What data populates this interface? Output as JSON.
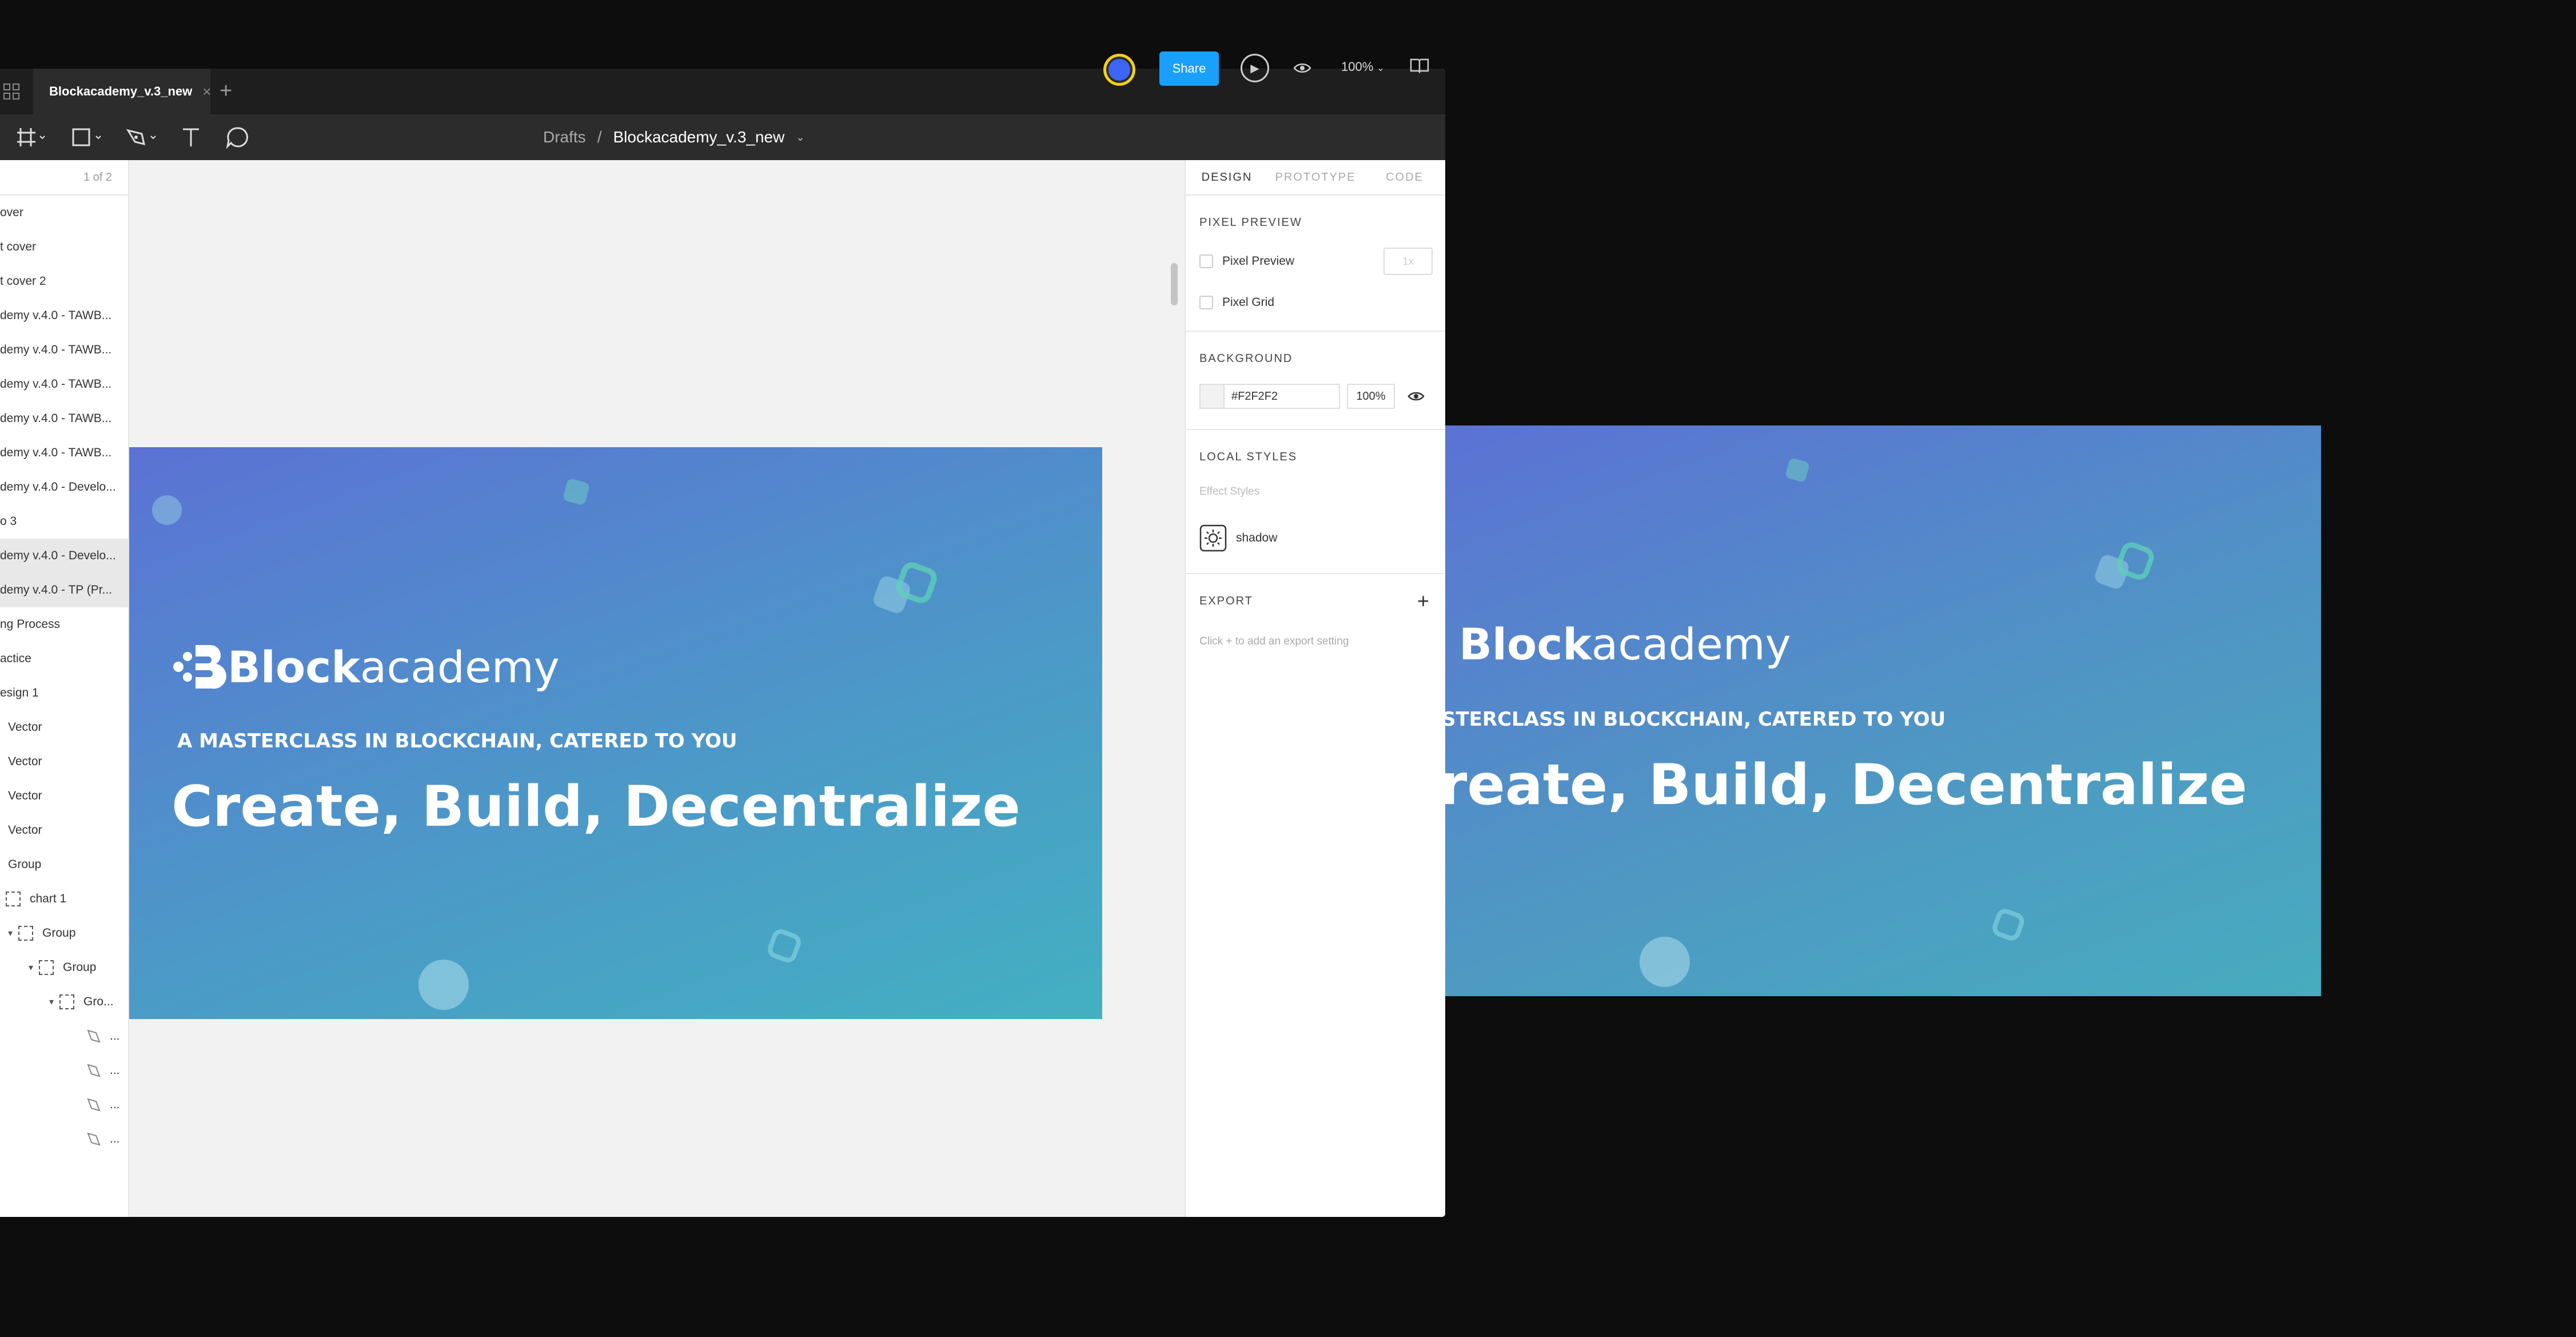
{
  "tabbar": {
    "file_tab": "Blockacademy_v.3_new",
    "close": "×",
    "add": "+"
  },
  "toolbar": {
    "breadcrumb_parent": "Drafts",
    "breadcrumb_sep": "/",
    "file_name": "Blockacademy_v.3_new",
    "share": "Share",
    "zoom": "100%"
  },
  "layers": {
    "pages_indicator": "1 of 2",
    "items": [
      {
        "label": "over"
      },
      {
        "label": "t cover"
      },
      {
        "label": "t cover 2"
      },
      {
        "label": "demy v.4.0 - TAWB..."
      },
      {
        "label": "demy v.4.0 - TAWB..."
      },
      {
        "label": "demy v.4.0 - TAWB..."
      },
      {
        "label": "demy v.4.0 - TAWB..."
      },
      {
        "label": "demy v.4.0 - TAWB..."
      },
      {
        "label": "demy v.4.0 - Develo..."
      },
      {
        "label": "o 3"
      },
      {
        "label": "demy v.4.0 - Develo..."
      },
      {
        "label": "demy v.4.0 - TP (Pr..."
      },
      {
        "label": "ng Process"
      },
      {
        "label": "actice"
      },
      {
        "label": "esign 1"
      },
      {
        "label": "Vector"
      },
      {
        "label": "Vector"
      },
      {
        "label": "Vector"
      },
      {
        "label": "Vector"
      },
      {
        "label": "Group"
      },
      {
        "label": "chart 1"
      },
      {
        "label": "Group"
      },
      {
        "label": "Group"
      },
      {
        "label": "Gro..."
      },
      {
        "label": "..."
      },
      {
        "label": "..."
      },
      {
        "label": "..."
      },
      {
        "label": "..."
      }
    ]
  },
  "banner": {
    "brand_bold": "Block",
    "brand_light": "academy",
    "tagline": "A MASTERCLASS IN BLOCKCHAIN, CATERED TO YOU",
    "headline": "Create, Build, Decentralize"
  },
  "banner_preview": {
    "tagline": "STERCLASS IN BLOCKCHAIN, CATERED TO YOU",
    "headline": "reate, Build, Decentralize"
  },
  "right_panel": {
    "tabs": [
      "DESIGN",
      "PROTOTYPE",
      "CODE"
    ],
    "pixel_preview": {
      "title": "PIXEL PREVIEW",
      "preview_label": "Pixel Preview",
      "grid_label": "Pixel Grid",
      "scale": "1x"
    },
    "background": {
      "title": "BACKGROUND",
      "hex": "#F2F2F2",
      "opacity": "100%"
    },
    "local_styles": {
      "title": "LOCAL STYLES",
      "subtitle": "Effect Styles",
      "style_name": "shadow"
    },
    "export": {
      "title": "EXPORT",
      "hint": "Click + to add an export setting",
      "add": "+"
    }
  },
  "help": "?",
  "colors": {
    "accent": "#18a0fb",
    "gradient_start": "#5b72d4",
    "gradient_end": "#43b0c1",
    "avatar_ring": "#f5d016"
  }
}
